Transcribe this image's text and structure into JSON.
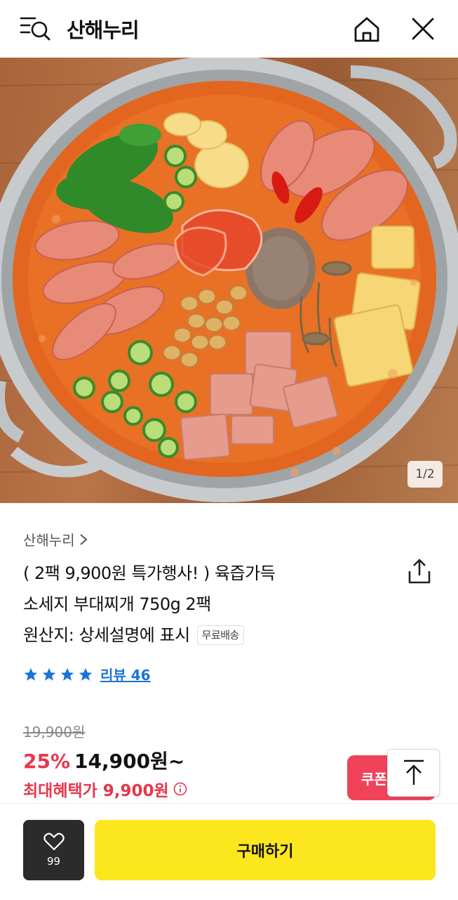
{
  "header": {
    "title": "산해누리",
    "icons": {
      "menu_search": "menu-search-icon",
      "home": "home-icon",
      "close": "close-icon"
    }
  },
  "gallery": {
    "counter": "1/2"
  },
  "product": {
    "shop_name": "산해누리",
    "title_line1": "( 2팩 9,900원 특가행사! ) 육즙가득",
    "title_line2": "소세지 부대찌개 750g 2팩",
    "title_line3": "원산지: 상세설명에 표시",
    "free_shipping_badge": "무료배송",
    "rating_stars": 4,
    "review_link": "리뷰 46",
    "original_price": "19,900원",
    "discount": "25%",
    "price": "14,900원~",
    "max_benefit": "최대혜택가 9,900원"
  },
  "actions": {
    "coupon_label": "쿠폰",
    "wish_count": "99",
    "buy_label": "구매하기"
  },
  "colors": {
    "accent_red": "#e8364b",
    "buy_yellow": "#fce61e",
    "link_blue": "#1a73d9",
    "dark": "#2b2b2b"
  }
}
